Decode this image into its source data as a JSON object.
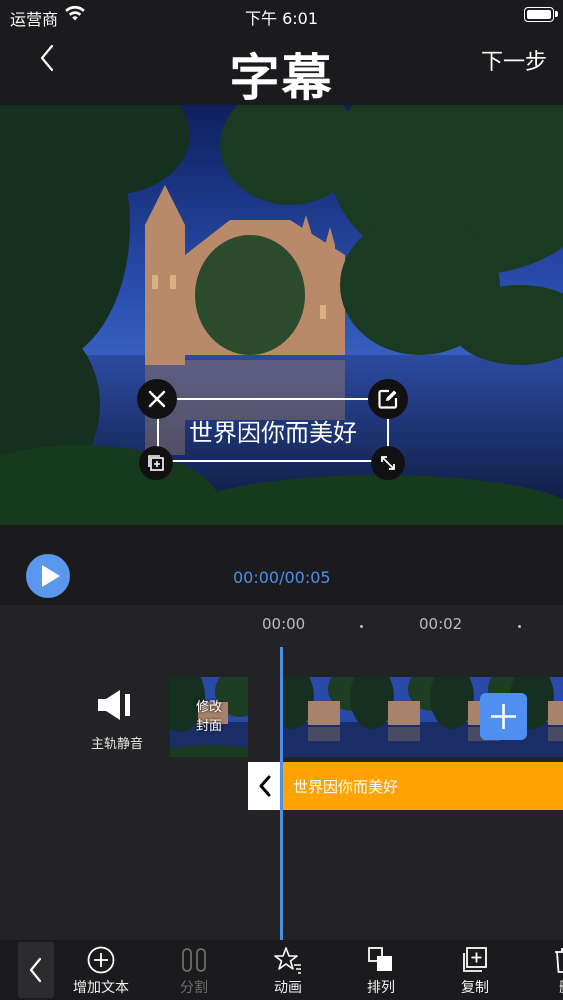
{
  "status_bar": {
    "carrier": "运营商",
    "time": "下午 6:01",
    "wifi_icon": "wifi-icon",
    "battery_icon": "battery-icon"
  },
  "nav": {
    "title": "字幕",
    "next_label": "下一步",
    "back_icon": "chevron-left-icon"
  },
  "preview": {
    "caption_text": "世界因你而美好",
    "handles": [
      "close-icon",
      "edit-icon",
      "duplicate-icon",
      "resize-icon"
    ]
  },
  "player": {
    "time": "00:00/00:05",
    "play_icon": "play-icon"
  },
  "timeline": {
    "ruler": [
      "00:00",
      "00:02"
    ],
    "mute_label": "主轨静音",
    "cover_label_line1": "修改",
    "cover_label_line2": "封面",
    "subtitle_text": "世界因你而美好",
    "add_clip_icon": "plus-icon"
  },
  "toolbar": {
    "items": [
      {
        "label": "增加文本",
        "icon": "add-circle-icon",
        "enabled": true
      },
      {
        "label": "分割",
        "icon": "split-icon",
        "enabled": false
      },
      {
        "label": "动画",
        "icon": "star-animation-icon",
        "enabled": true
      },
      {
        "label": "排列",
        "icon": "arrange-layers-icon",
        "enabled": true
      },
      {
        "label": "复制",
        "icon": "copy-icon",
        "enabled": true
      },
      {
        "label": "删",
        "icon": "delete-icon",
        "enabled": true
      }
    ]
  },
  "colors": {
    "accent": "#4f8fe8",
    "subtitle_track": "#fea301",
    "background": "#1b1b1d"
  }
}
